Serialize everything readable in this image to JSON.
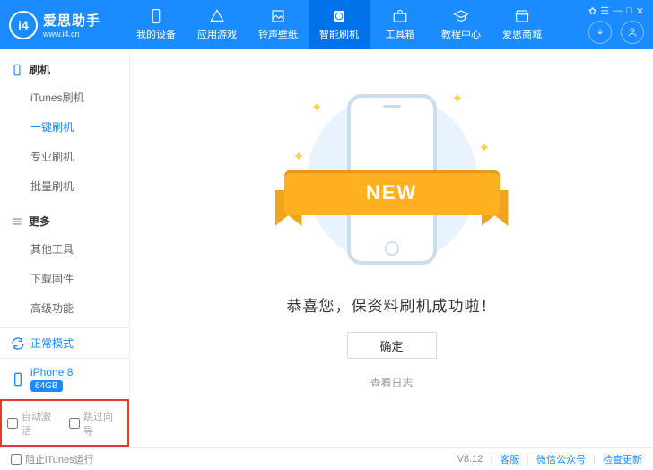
{
  "app": {
    "brand_main": "爱思助手",
    "brand_sub": "www.i4.cn",
    "logo_text": "i4"
  },
  "nav": {
    "items": [
      {
        "id": "device",
        "label": "我的设备"
      },
      {
        "id": "apps",
        "label": "应用游戏"
      },
      {
        "id": "ring",
        "label": "铃声壁纸"
      },
      {
        "id": "flash",
        "label": "智能刷机"
      },
      {
        "id": "toolbox",
        "label": "工具箱"
      },
      {
        "id": "tutorial",
        "label": "教程中心"
      },
      {
        "id": "store",
        "label": "爱思商城"
      }
    ],
    "active_index": 3
  },
  "header_right": {
    "mini_icons": [
      "✿",
      "☰",
      "—",
      "□",
      "✕"
    ]
  },
  "sidebar": {
    "sections": [
      {
        "title": "刷机",
        "items": [
          "iTunes刷机",
          "一键刷机",
          "专业刷机",
          "批量刷机"
        ],
        "active_index": 1,
        "icon": "phone"
      },
      {
        "title": "更多",
        "items": [
          "其他工具",
          "下载固件",
          "高级功能"
        ],
        "active_index": -1,
        "icon": "list"
      }
    ],
    "mode_block": {
      "label": "正常模式",
      "icon": "refresh"
    },
    "device_block": {
      "name": "iPhone 8",
      "storage": "64GB"
    },
    "check_auto_activate": "自动激活",
    "check_skip_guide": "跳过向导"
  },
  "main": {
    "ribbon_text": "NEW",
    "success_msg": "恭喜您，保资料刷机成功啦！",
    "ok_btn": "确定",
    "log_link": "查看日志"
  },
  "footer": {
    "block_itunes": "阻止iTunes运行",
    "version": "V8.12",
    "links": [
      "客服",
      "微信公众号",
      "检查更新"
    ]
  }
}
